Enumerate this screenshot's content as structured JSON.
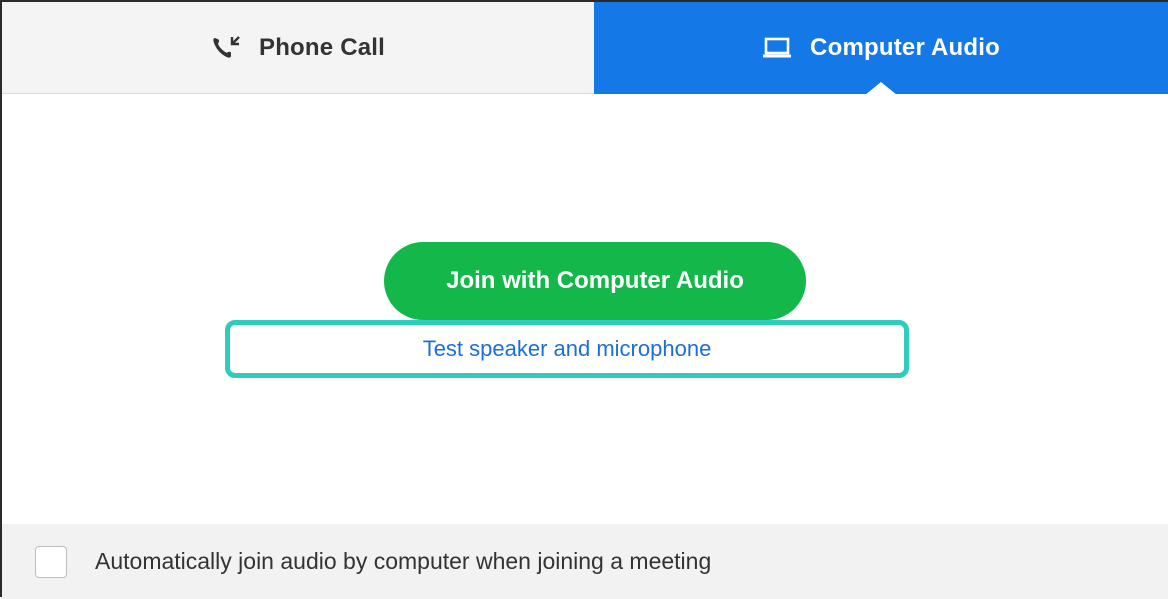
{
  "tabs": {
    "phone": {
      "label": "Phone Call",
      "icon": "phone-call-icon"
    },
    "computer": {
      "label": "Computer Audio",
      "icon": "laptop-icon",
      "active": true
    }
  },
  "main": {
    "join_button_label": "Join with Computer Audio",
    "test_link_label": "Test speaker and microphone"
  },
  "footer": {
    "auto_join_label": "Automatically join audio by computer when joining a meeting",
    "auto_join_checked": false
  },
  "colors": {
    "active_tab": "#1479e6",
    "join_button": "#14b84a",
    "highlight_border": "#2ecbbe",
    "link": "#1a6fd8"
  }
}
